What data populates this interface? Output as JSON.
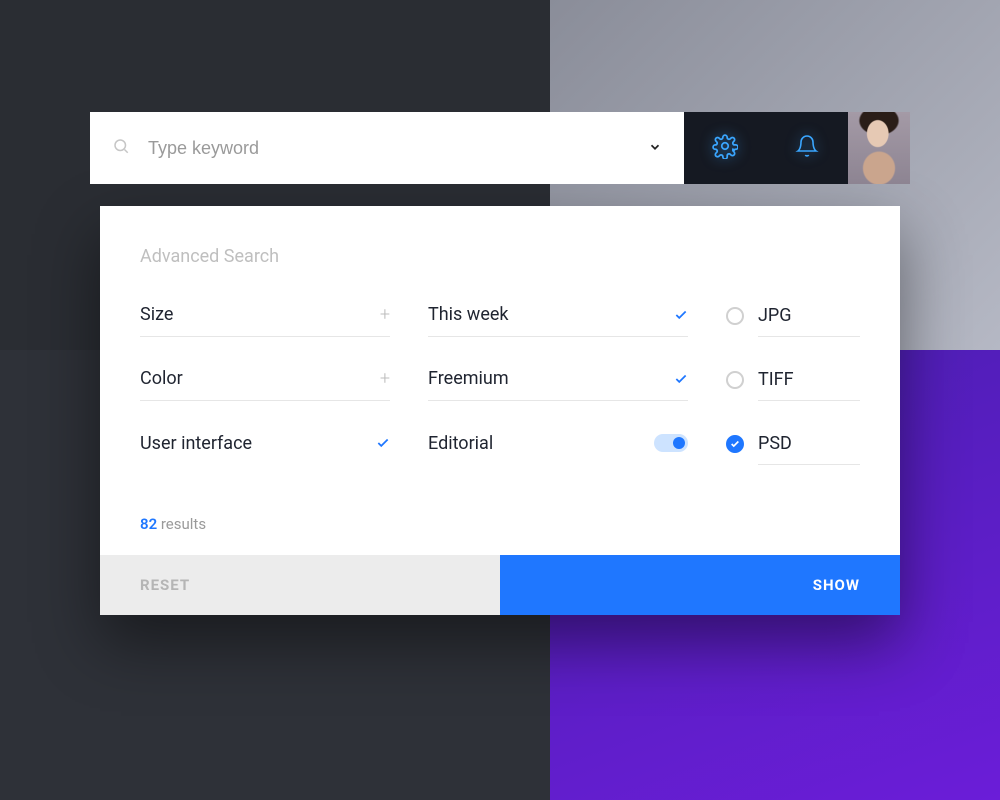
{
  "search": {
    "placeholder": "Type keyword"
  },
  "panel": {
    "title": "Advanced Search",
    "col1": [
      {
        "label": "Size",
        "type": "expand"
      },
      {
        "label": "Color",
        "type": "expand"
      },
      {
        "label": "User interface",
        "type": "checked"
      }
    ],
    "col2": [
      {
        "label": "This week",
        "type": "checked"
      },
      {
        "label": "Freemium",
        "type": "checked"
      },
      {
        "label": "Editorial",
        "type": "toggle",
        "on": true
      }
    ],
    "col3": [
      {
        "label": "JPG",
        "selected": false
      },
      {
        "label": "TIFF",
        "selected": false
      },
      {
        "label": "PSD",
        "selected": true
      }
    ],
    "results": {
      "count": "82",
      "word": " results"
    },
    "actions": {
      "reset": "RESET",
      "show": "SHOW"
    }
  }
}
